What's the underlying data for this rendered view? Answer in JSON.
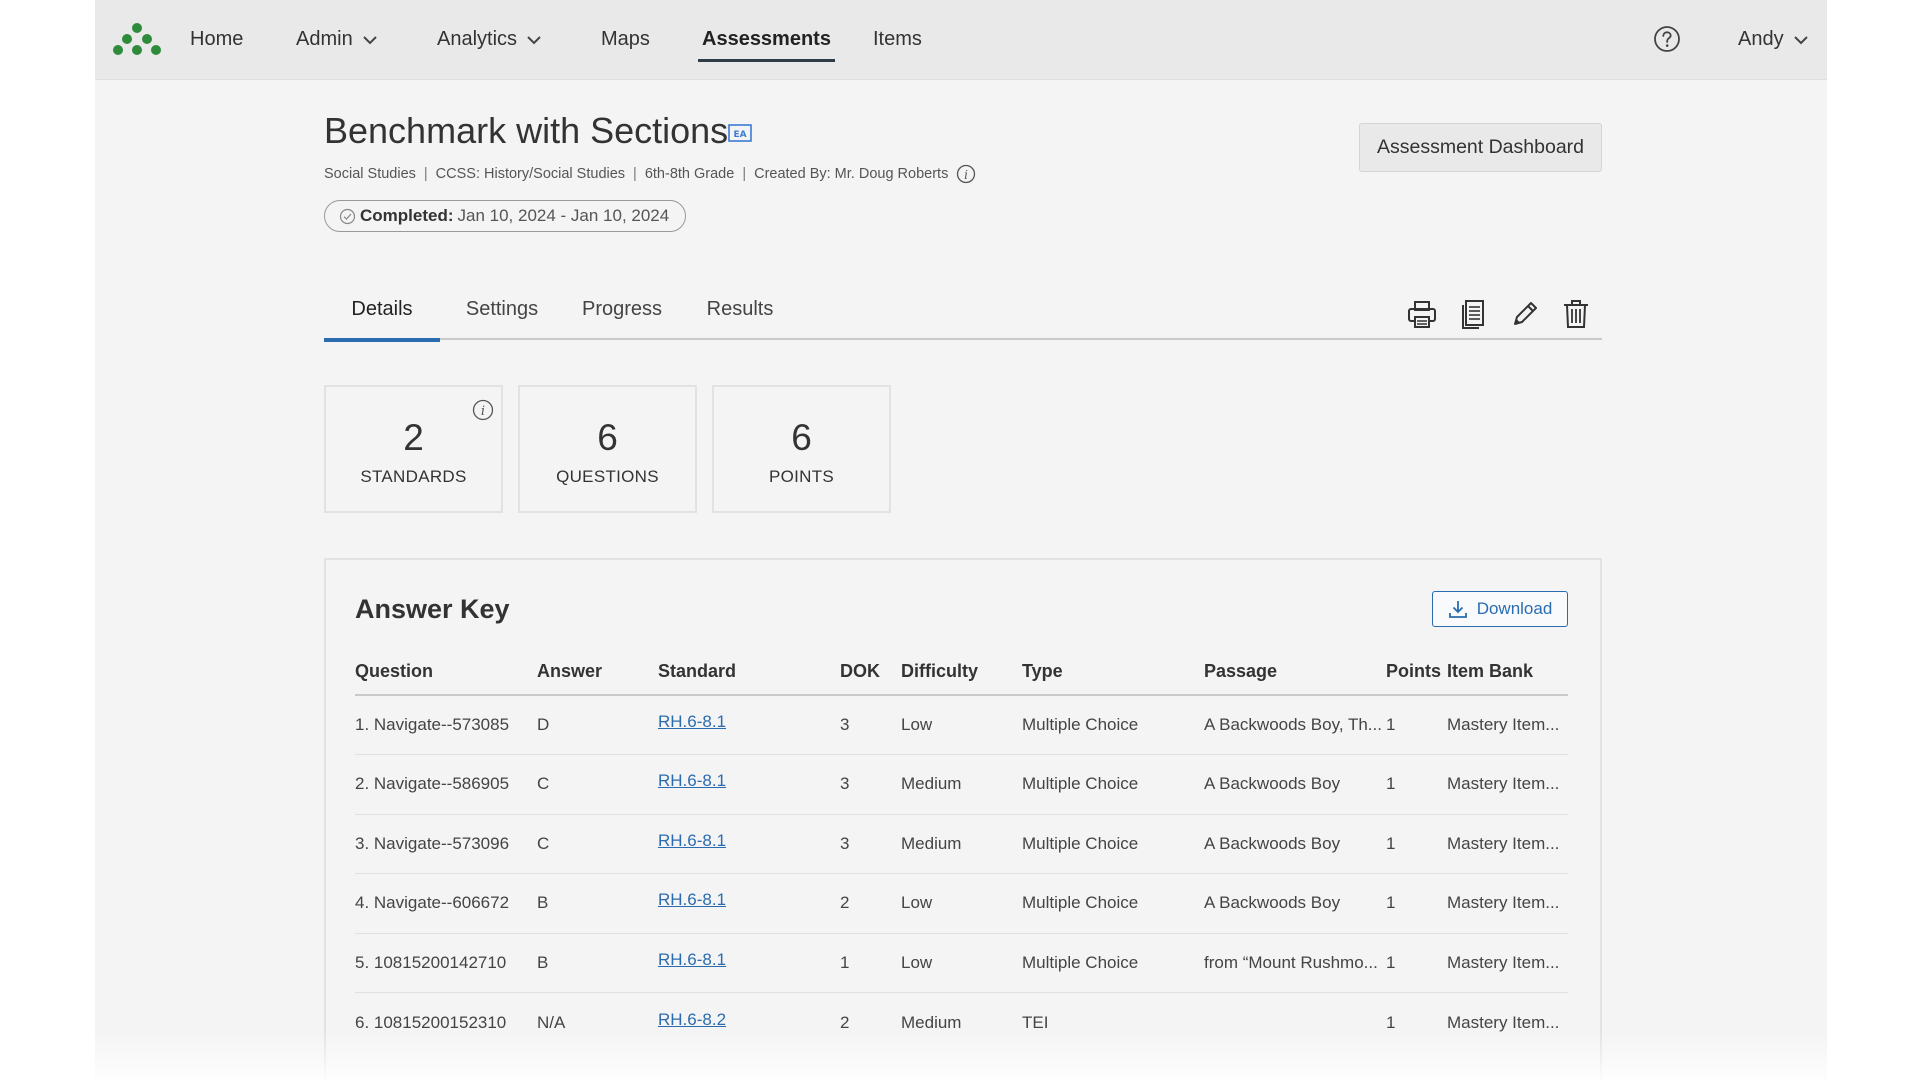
{
  "nav": {
    "items": [
      {
        "label": "Home",
        "has_dropdown": false,
        "active": false
      },
      {
        "label": "Admin",
        "has_dropdown": true,
        "active": false
      },
      {
        "label": "Analytics",
        "has_dropdown": true,
        "active": false
      },
      {
        "label": "Maps",
        "has_dropdown": false,
        "active": false
      },
      {
        "label": "Assessments",
        "has_dropdown": false,
        "active": true
      },
      {
        "label": "Items",
        "has_dropdown": false,
        "active": false
      }
    ],
    "user_label": "Andy",
    "help_icon": "question-circle-icon",
    "logo_icon": "dots-logo-icon",
    "logo_color": "#2e8b3a"
  },
  "header": {
    "title": "Benchmark with Sections",
    "title_badge_icon": "ea-badge-icon",
    "meta": {
      "subject": "Social Studies",
      "standard_set": "CCSS: History/Social Studies",
      "grade": "6th-8th Grade",
      "created_by": "Created By: Mr. Doug Roberts"
    },
    "status": {
      "label": "Completed:",
      "dates": "Jan 10, 2024 - Jan 10, 2024"
    },
    "dashboard_button": "Assessment Dashboard"
  },
  "tabs": [
    {
      "label": "Details",
      "active": true
    },
    {
      "label": "Settings",
      "active": false
    },
    {
      "label": "Progress",
      "active": false
    },
    {
      "label": "Results",
      "active": false
    }
  ],
  "toolbar_icons": [
    "print-icon",
    "document-icon",
    "edit-pencil-icon",
    "trash-icon"
  ],
  "stats": [
    {
      "value": "2",
      "label": "STANDARDS",
      "has_info": true
    },
    {
      "value": "6",
      "label": "QUESTIONS",
      "has_info": false
    },
    {
      "value": "6",
      "label": "POINTS",
      "has_info": false
    }
  ],
  "answer_key": {
    "title": "Answer Key",
    "download_label": "Download",
    "columns": [
      "Question",
      "Answer",
      "Standard",
      "DOK",
      "Difficulty",
      "Type",
      "Passage",
      "Points",
      "Item Bank"
    ],
    "rows": [
      [
        "1. Navigate--573085",
        "D",
        "RH.6-8.1",
        "3",
        "Low",
        "Multiple Choice",
        "A Backwoods Boy, Th...",
        "1",
        "Mastery Item..."
      ],
      [
        "2. Navigate--586905",
        "C",
        "RH.6-8.1",
        "3",
        "Medium",
        "Multiple Choice",
        "A Backwoods Boy",
        "1",
        "Mastery Item..."
      ],
      [
        "3. Navigate--573096",
        "C",
        "RH.6-8.1",
        "3",
        "Medium",
        "Multiple Choice",
        "A Backwoods Boy",
        "1",
        "Mastery Item..."
      ],
      [
        "4. Navigate--606672",
        "B",
        "RH.6-8.1",
        "2",
        "Low",
        "Multiple Choice",
        "A Backwoods Boy",
        "1",
        "Mastery Item..."
      ],
      [
        "5. 10815200142710",
        "B",
        "RH.6-8.1",
        "1",
        "Low",
        "Multiple Choice",
        "from “Mount Rushmo...",
        "1",
        "Mastery Item..."
      ],
      [
        "6. 10815200152310",
        "N/A",
        "RH.6-8.2",
        "2",
        "Medium",
        "TEI",
        "",
        "1",
        "Mastery Item..."
      ]
    ]
  },
  "colors": {
    "accent": "#2b6cb0",
    "nav_background": "#e9e9e9",
    "page_background": "#f4f4f4"
  }
}
